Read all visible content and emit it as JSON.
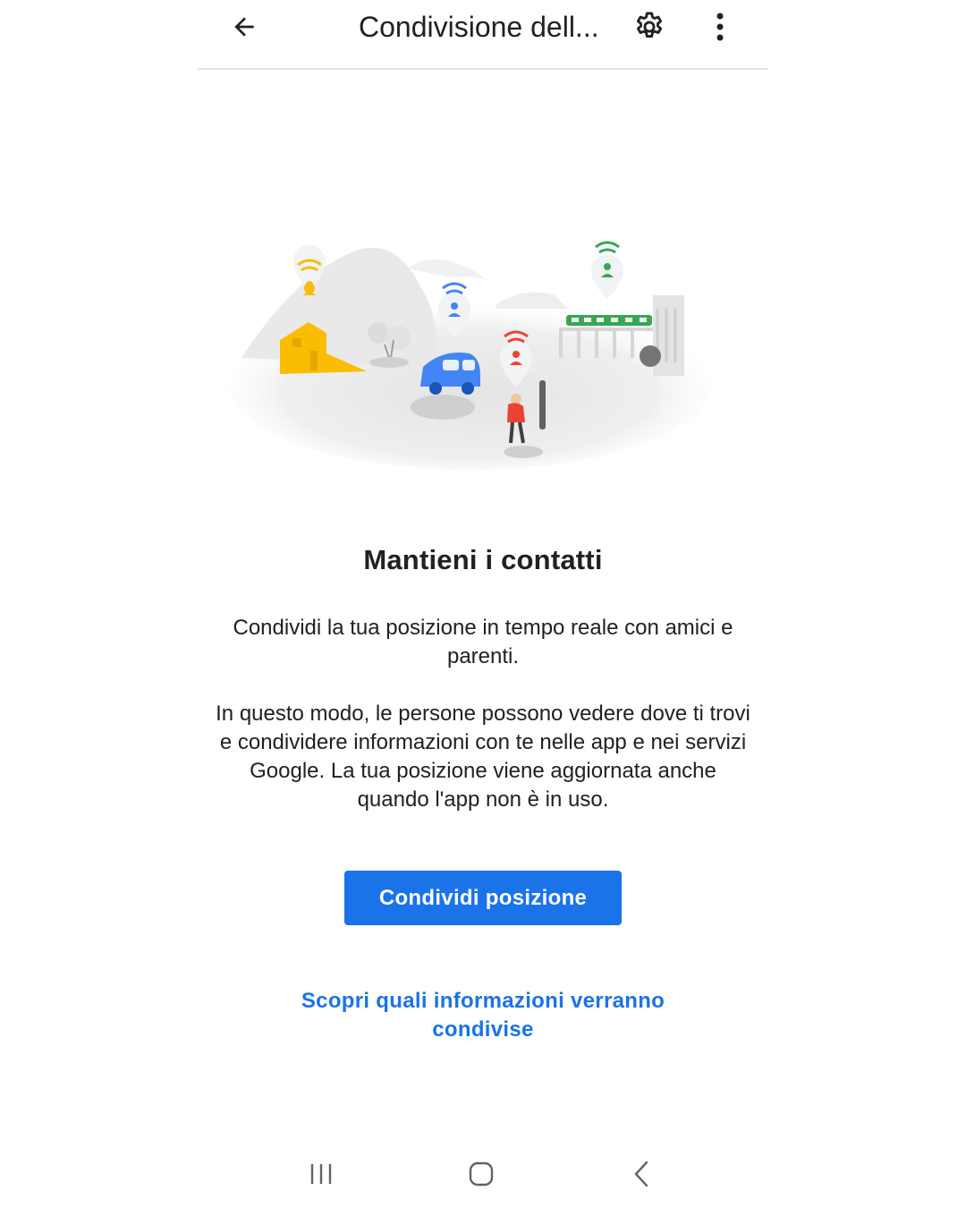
{
  "app_bar": {
    "title": "Condivisione dell...",
    "back_icon": "arrow-back-icon",
    "settings_icon": "gear-icon",
    "more_icon": "more-vert-icon"
  },
  "illustration": {
    "description_icon": "location-sharing-illustration",
    "pin_colors": [
      "#fbbc04",
      "#4285f4",
      "#ea4335",
      "#34a853"
    ]
  },
  "main": {
    "heading": "Mantieni i contatti",
    "paragraph1": "Condividi la tua posizione in tempo reale con amici e parenti.",
    "paragraph2": "In questo modo, le persone possono vedere dove ti trovi e condividere informazioni con te nelle app e nei servizi Google. La tua posizione viene aggiornata anche quando l'app non è in uso.",
    "primary_button": "Condividi posizione",
    "link": "Scopri quali informazioni verranno condivise"
  },
  "nav_bar": {
    "recents_icon": "recents-icon",
    "home_icon": "home-icon",
    "back_icon": "nav-back-icon"
  },
  "colors": {
    "accent": "#1a73e8",
    "text": "#202124",
    "divider": "#e3e3e3"
  }
}
